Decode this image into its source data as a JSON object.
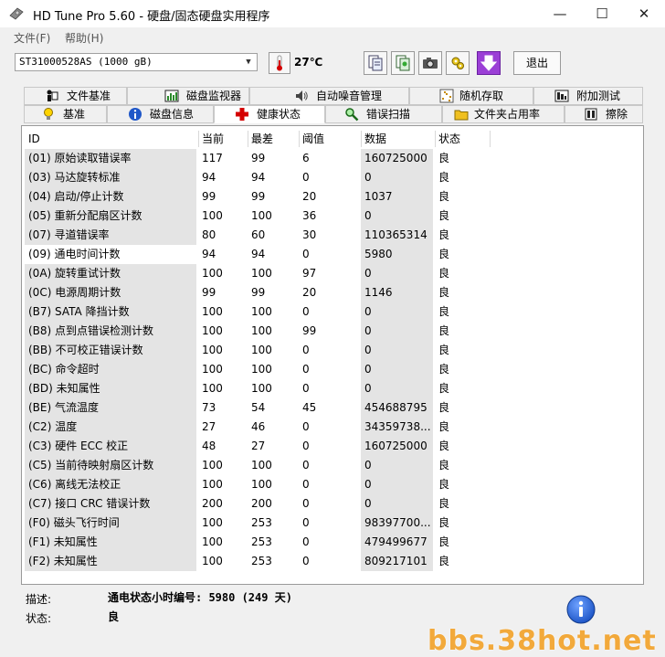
{
  "window": {
    "title": "HD Tune Pro 5.60 - 硬盘/固态硬盘实用程序",
    "minimize": "—",
    "maximize": "☐",
    "close": "✕"
  },
  "menu": [
    "文件(F)",
    "帮助(H)"
  ],
  "toolbar": {
    "drive": "ST31000528AS (1000 gB)",
    "temperature": "27℃",
    "exit_label": "退出"
  },
  "tabs_top": [
    "文件基准",
    "磁盘监视器",
    "自动噪音管理",
    "随机存取",
    "附加测试"
  ],
  "tabs_bottom": [
    "基准",
    "磁盘信息",
    "健康状态",
    "错误扫描",
    "文件夹占用率",
    "擦除"
  ],
  "active_tab": "健康状态",
  "table": {
    "headers": [
      "ID",
      "当前",
      "最差",
      "阈值",
      "数据",
      "状态"
    ],
    "rows": [
      [
        "(01) 原始读取错误率",
        "117",
        "99",
        "6",
        "160725000",
        "良"
      ],
      [
        "(03) 马达旋转标准",
        "94",
        "94",
        "0",
        "0",
        "良"
      ],
      [
        "(04) 启动/停止计数",
        "99",
        "99",
        "20",
        "1037",
        "良"
      ],
      [
        "(05) 重新分配扇区计数",
        "100",
        "100",
        "36",
        "0",
        "良"
      ],
      [
        "(07) 寻道错误率",
        "80",
        "60",
        "30",
        "110365314",
        "良"
      ],
      [
        "(09) 通电时间计数",
        "94",
        "94",
        "0",
        "5980",
        "良"
      ],
      [
        "(0A) 旋转重试计数",
        "100",
        "100",
        "97",
        "0",
        "良"
      ],
      [
        "(0C) 电源周期计数",
        "99",
        "99",
        "20",
        "1146",
        "良"
      ],
      [
        "(B7) SATA 降挡计数",
        "100",
        "100",
        "0",
        "0",
        "良"
      ],
      [
        "(B8) 点到点错误检测计数",
        "100",
        "100",
        "99",
        "0",
        "良"
      ],
      [
        "(BB) 不可校正错误计数",
        "100",
        "100",
        "0",
        "0",
        "良"
      ],
      [
        "(BC) 命令超时",
        "100",
        "100",
        "0",
        "0",
        "良"
      ],
      [
        "(BD) 未知属性",
        "100",
        "100",
        "0",
        "0",
        "良"
      ],
      [
        "(BE) 气流温度",
        "73",
        "54",
        "45",
        "454688795",
        "良"
      ],
      [
        "(C2) 温度",
        "27",
        "46",
        "0",
        "34359738...",
        "良"
      ],
      [
        "(C3) 硬件 ECC 校正",
        "48",
        "27",
        "0",
        "160725000",
        "良"
      ],
      [
        "(C5) 当前待映射扇区计数",
        "100",
        "100",
        "0",
        "0",
        "良"
      ],
      [
        "(C6) 离线无法校正",
        "100",
        "100",
        "0",
        "0",
        "良"
      ],
      [
        "(C7) 接口 CRC 错误计数",
        "200",
        "200",
        "0",
        "0",
        "良"
      ],
      [
        "(F0) 磁头飞行时间",
        "100",
        "253",
        "0",
        "98397700...",
        "良"
      ],
      [
        "(F1) 未知属性",
        "100",
        "253",
        "0",
        "479499677",
        "良"
      ],
      [
        "(F2) 未知属性",
        "100",
        "253",
        "0",
        "809217101",
        "良"
      ]
    ],
    "selected_row": 5
  },
  "footer": {
    "desc_label": "描述:",
    "desc_value": "通电状态小时编号: 5980 (249 天)",
    "status_label": "状态:",
    "status_value": "良"
  },
  "watermark": "bbs.38hot.net",
  "colors": {
    "accent_red": "#d40000",
    "cell_gray": "#e4e4e4",
    "watermark": "#f2a93b",
    "info_blue": "#1f57c8"
  }
}
